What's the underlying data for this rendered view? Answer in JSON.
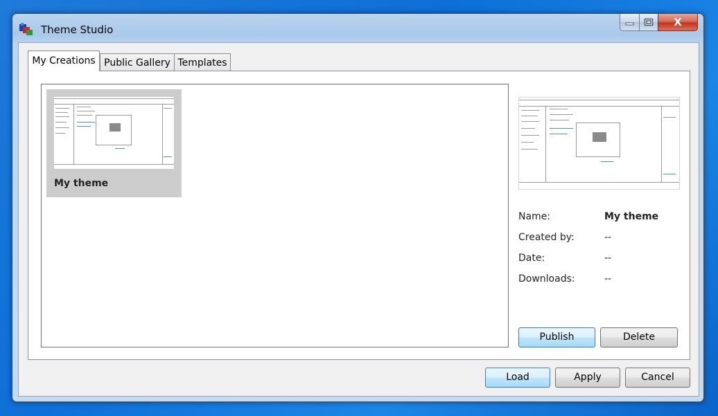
{
  "window": {
    "title": "Theme Studio"
  },
  "caption_buttons": {
    "minimize": "minimize-icon",
    "maximize": "restore-icon",
    "close": "X"
  },
  "tabs": [
    {
      "label": "My Creations",
      "active": true
    },
    {
      "label": "Public Gallery",
      "active": false
    },
    {
      "label": "Templates",
      "active": false
    }
  ],
  "gallery": {
    "items": [
      {
        "name": "My theme",
        "selected": true
      }
    ]
  },
  "details": {
    "rows": [
      {
        "label": "Name:",
        "value": "My theme"
      },
      {
        "label": "Created by:",
        "value": "--"
      },
      {
        "label": "Date:",
        "value": "--"
      },
      {
        "label": "Downloads:",
        "value": "--"
      }
    ],
    "publish_label": "Publish",
    "delete_label": "Delete"
  },
  "footer": {
    "load_label": "Load",
    "apply_label": "Apply",
    "cancel_label": "Cancel"
  },
  "colors": {
    "selection": "#cccccc",
    "default_button": "#bee6fd",
    "close_button": "#c0371f"
  }
}
